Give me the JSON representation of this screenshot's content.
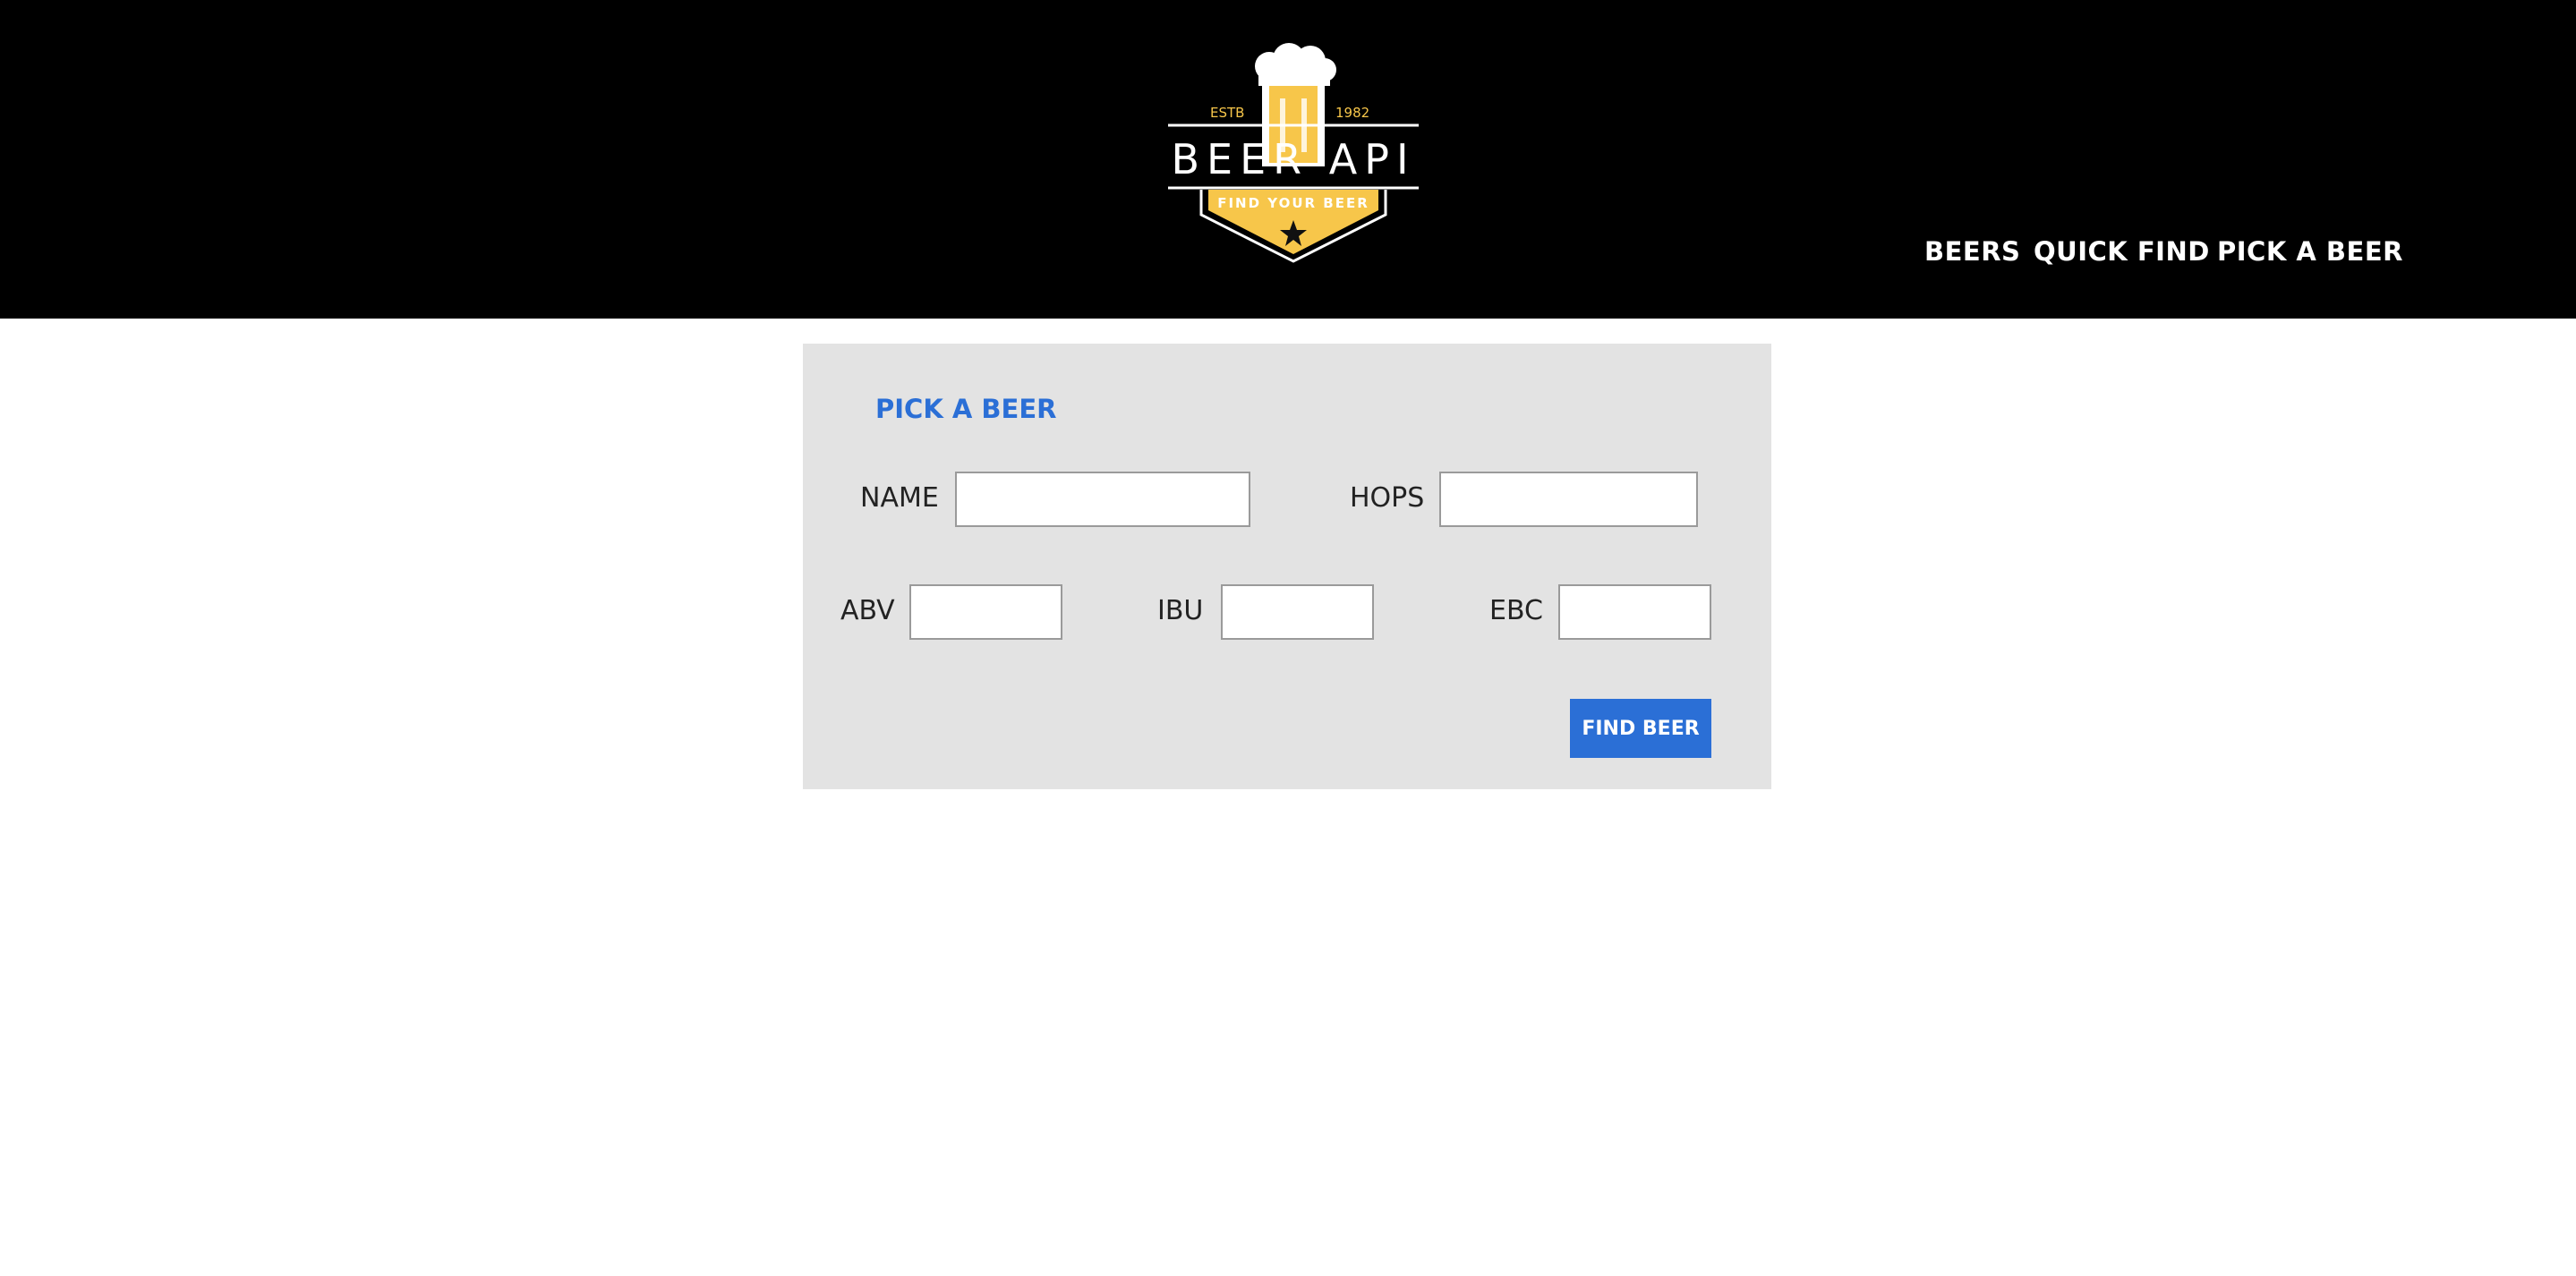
{
  "brand": {
    "estb": "ESTB",
    "year": "1982",
    "name": "BEER API",
    "tagline": "FIND YOUR BEER",
    "colors": {
      "gold": "#f7c64a",
      "black": "#000000",
      "white": "#ffffff"
    }
  },
  "nav": {
    "items": [
      {
        "label": "BEERS"
      },
      {
        "label": "QUICK FIND"
      },
      {
        "label": "PICK A BEER"
      }
    ]
  },
  "form": {
    "title": "PICK A BEER",
    "fields": {
      "name": {
        "label": "NAME",
        "value": ""
      },
      "hops": {
        "label": "HOPS",
        "value": ""
      },
      "abv": {
        "label": "ABV",
        "value": ""
      },
      "ibu": {
        "label": "IBU",
        "value": ""
      },
      "ebc": {
        "label": "EBC",
        "value": ""
      }
    },
    "submit_label": "FIND BEER"
  },
  "colors": {
    "accent": "#2b6fd6",
    "panel_bg": "#e3e3e3",
    "header_bg": "#000000"
  }
}
